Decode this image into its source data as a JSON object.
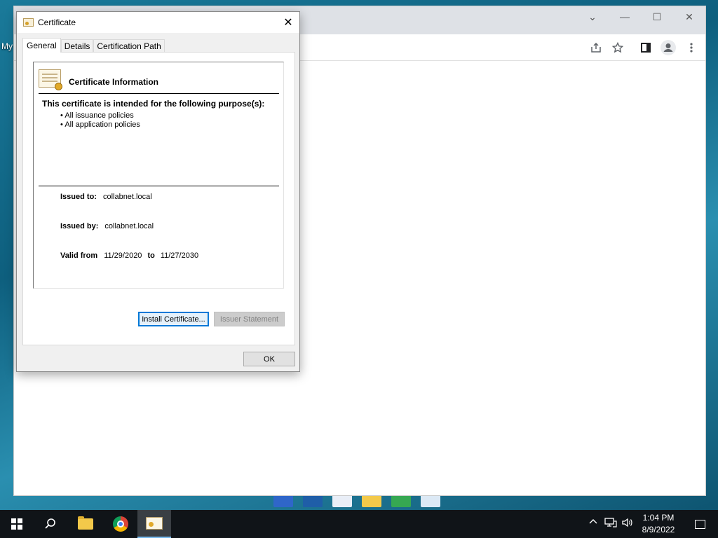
{
  "desktop": {
    "partial_label": "My"
  },
  "browser": {
    "controls": {
      "tab_search": "⌄",
      "minimize": "—",
      "maximize": "☐",
      "close": "✕"
    },
    "toolbar_icons": [
      "share-icon",
      "star-icon",
      "side-panel-icon",
      "profile-icon",
      "menu-icon"
    ]
  },
  "dialog": {
    "title": "Certificate",
    "close_glyph": "✕",
    "tabs": [
      {
        "label": "General",
        "active": true
      },
      {
        "label": "Details",
        "active": false
      },
      {
        "label": "Certification Path",
        "active": false
      }
    ],
    "heading": "Certificate Information",
    "purpose_heading": "This certificate is intended for the following purpose(s):",
    "purposes": [
      "All issuance policies",
      "All application policies"
    ],
    "issued_to_label": "Issued to:",
    "issued_to": "collabnet.local",
    "issued_by_label": "Issued by:",
    "issued_by": "collabnet.local",
    "valid_from_label": "Valid from",
    "valid_from": "11/29/2020",
    "valid_to_label": "to",
    "valid_to": "11/27/2030",
    "install_button": "Install Certificate...",
    "issuer_statement_button": "Issuer Statement",
    "ok_button": "OK"
  },
  "taskbar": {
    "apps": [
      "start-icon",
      "search-icon",
      "file-explorer-icon",
      "chrome-icon",
      "certificate-icon"
    ],
    "clock_time": "1:04 PM",
    "clock_date": "8/9/2022"
  },
  "colors": {
    "focus_blue": "#0078d7",
    "taskbar": "#101418",
    "dialog_bg": "#f0f0f0"
  }
}
